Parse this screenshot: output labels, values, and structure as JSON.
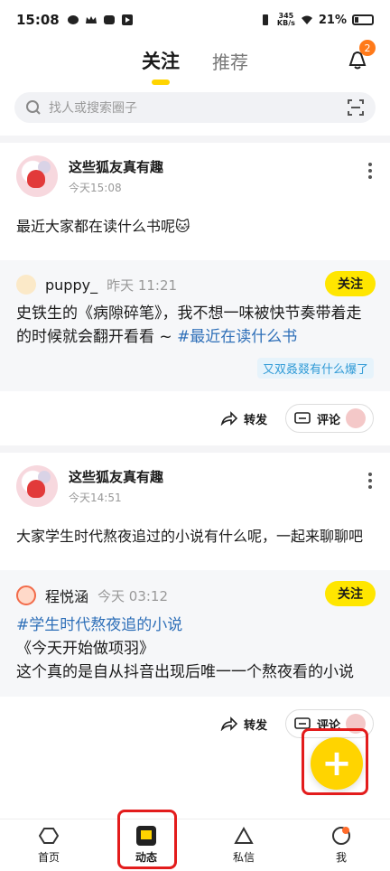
{
  "status_bar": {
    "time": "15:08",
    "speed": "345\nKB/s",
    "battery": "21%"
  },
  "topbar": {
    "tabs": [
      {
        "label": "关注",
        "active": true
      },
      {
        "label": "推荐",
        "active": false
      }
    ],
    "notification_count": "2"
  },
  "search": {
    "placeholder": "找人或搜索圈子"
  },
  "posts": [
    {
      "author": "这些狐友真有趣",
      "time": "今天15:08",
      "text": "最近大家都在读什么书呢🐱",
      "quote": {
        "name": "puppy_",
        "time": "昨天 11:21",
        "follow": "关注",
        "body_prefix": "史铁生的《病隙碎笔》，我不想一味被快节奏带着走的时候就会翻开看看 ~ ",
        "hashtag": "#最近在读什么书",
        "topic": "又双叒叕有什么爆了"
      },
      "actions": {
        "share": "转发",
        "comment": "评论"
      }
    },
    {
      "author": "这些狐友真有趣",
      "time": "今天14:51",
      "text": "大家学生时代熬夜追过的小说有什么呢，一起来聊聊吧",
      "quote": {
        "name": "程悦涵",
        "time": "今天 03:12",
        "follow": "关注",
        "hashtag": "#学生时代熬夜追的小说",
        "body_lines": [
          "《今天开始做项羽》",
          "这个真的是自从抖音出现后唯一一个熬夜看的小说"
        ]
      },
      "actions": {
        "share": "转发",
        "comment": "评论"
      }
    }
  ],
  "bottom_nav": [
    {
      "label": "首页"
    },
    {
      "label": "动态",
      "active": true
    },
    {
      "label": "私信"
    },
    {
      "label": "我"
    }
  ],
  "fab_label": "+"
}
